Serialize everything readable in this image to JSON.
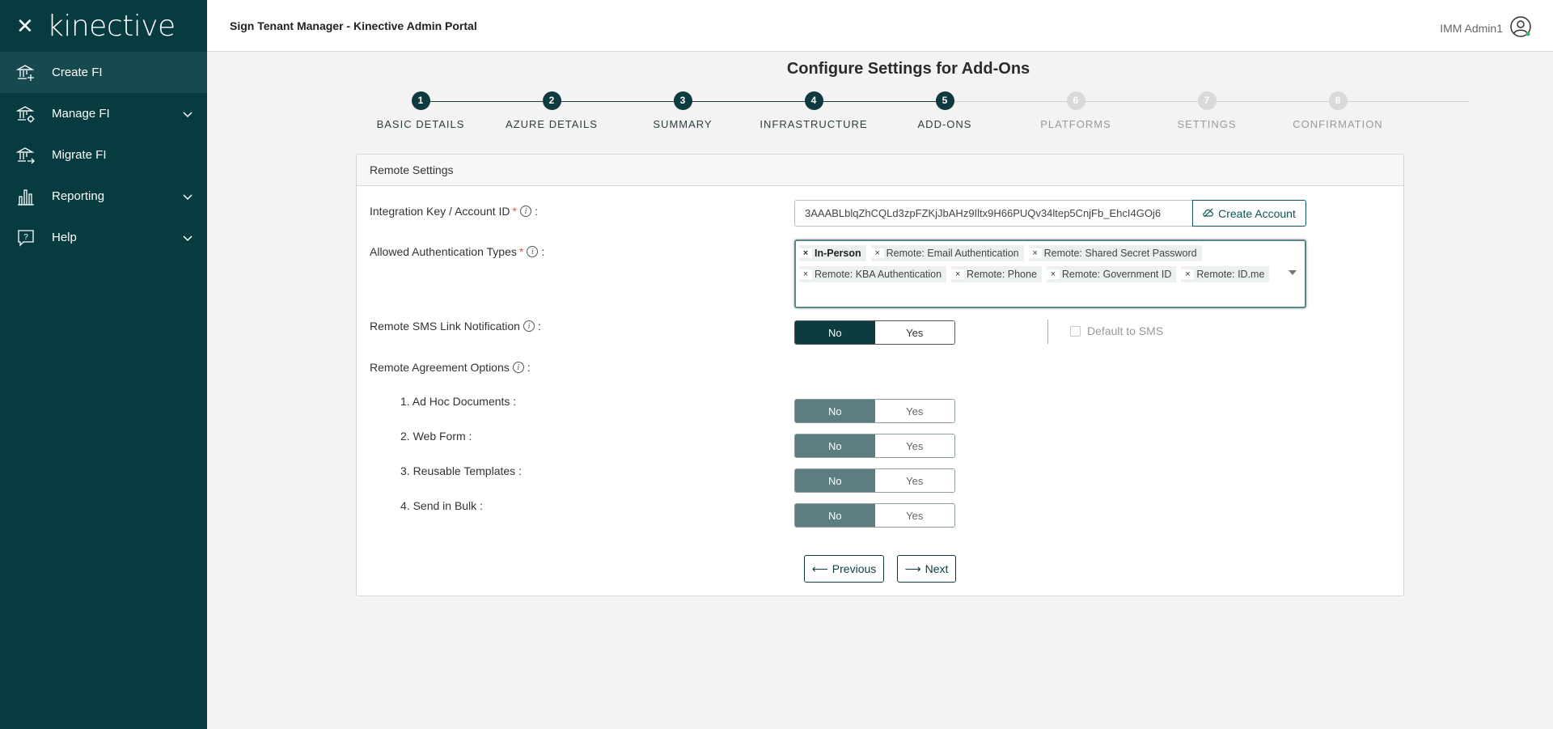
{
  "sidebar": {
    "close_icon": "close-icon",
    "logo": "kinective",
    "items": [
      {
        "label": "Create FI",
        "icon": "bank-add-icon",
        "active": true
      },
      {
        "label": "Manage FI",
        "icon": "bank-gear-icon",
        "chevron": true
      },
      {
        "label": "Migrate FI",
        "icon": "bank-migrate-icon"
      },
      {
        "label": "Reporting",
        "icon": "bar-chart-icon",
        "chevron": true
      },
      {
        "label": "Help",
        "icon": "help-icon",
        "chevron": true
      }
    ]
  },
  "topbar": {
    "title": "Sign Tenant Manager - Kinective Admin Portal",
    "user": "IMM Admin1"
  },
  "page": {
    "title": "Configure Settings for Add-Ons"
  },
  "stepper": {
    "steps": [
      {
        "num": "1",
        "label": "BASIC DETAILS",
        "state": "done"
      },
      {
        "num": "2",
        "label": "AZURE DETAILS",
        "state": "done"
      },
      {
        "num": "3",
        "label": "SUMMARY",
        "state": "done"
      },
      {
        "num": "4",
        "label": "INFRASTRUCTURE",
        "state": "done"
      },
      {
        "num": "5",
        "label": "ADD-ONS",
        "state": "current"
      },
      {
        "num": "6",
        "label": "PLATFORMS",
        "state": "pending"
      },
      {
        "num": "7",
        "label": "SETTINGS",
        "state": "pending"
      },
      {
        "num": "8",
        "label": "CONFIRMATION",
        "state": "pending"
      }
    ]
  },
  "form": {
    "section_title": "Remote Settings",
    "integration_key": {
      "label": "Integration Key / Account ID",
      "value": "3AAABLblqZhCQLd3zpFZKjJbAHz9Iltx9H66PUQv34ltep5CnjFb_EhcI4GOj6",
      "button": "Create Account"
    },
    "auth_types": {
      "label": "Allowed Authentication Types",
      "chips": [
        "In-Person",
        "Remote: Email Authentication",
        "Remote: Shared Secret Password",
        "Remote: KBA Authentication",
        "Remote: Phone",
        "Remote: Government ID",
        "Remote: ID.me"
      ]
    },
    "sms_link": {
      "label": "Remote SMS Link Notification",
      "no": "No",
      "yes": "Yes",
      "selected": "No",
      "default_sms": "Default to SMS"
    },
    "agreement": {
      "label": "Remote Agreement Options",
      "options": [
        {
          "label": "1. Ad Hoc Documents :",
          "no": "No",
          "yes": "Yes",
          "selected": "No"
        },
        {
          "label": "2. Web Form :",
          "no": "No",
          "yes": "Yes",
          "selected": "No"
        },
        {
          "label": "3. Reusable Templates :",
          "no": "No",
          "yes": "Yes",
          "selected": "No"
        },
        {
          "label": "4. Send in Bulk :",
          "no": "No",
          "yes": "Yes",
          "selected": "No"
        }
      ]
    },
    "colon": ":",
    "required_mark": "*",
    "info_glyph": "i"
  },
  "buttons": {
    "previous": "Previous",
    "next": "Next"
  }
}
